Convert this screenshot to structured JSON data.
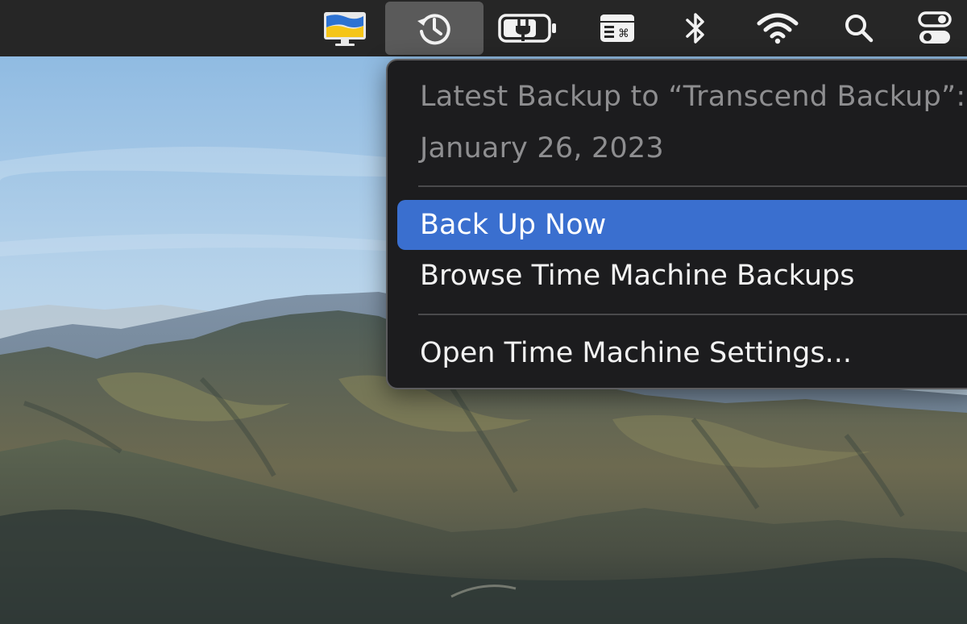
{
  "menubar": {
    "items": [
      {
        "id": "ukraine-monitor",
        "icon": "ukraine-flag-display-icon",
        "active": false
      },
      {
        "id": "time-machine",
        "icon": "time-machine-clock-icon",
        "active": true
      },
      {
        "id": "battery",
        "icon": "battery-charging-icon",
        "active": false
      },
      {
        "id": "keyboard-shortcuts",
        "icon": "command-window-icon",
        "active": false
      },
      {
        "id": "bluetooth",
        "icon": "bluetooth-icon",
        "active": false
      },
      {
        "id": "wifi",
        "icon": "wifi-icon",
        "active": false
      },
      {
        "id": "spotlight",
        "icon": "search-icon",
        "active": false
      },
      {
        "id": "control-center",
        "icon": "control-center-toggle-icon",
        "active": false
      }
    ]
  },
  "time_machine_menu": {
    "header_line1": "Latest Backup to “Transcend Backup”:",
    "header_line2": "January 26, 2023",
    "items": [
      {
        "label": "Back Up Now",
        "selected": true
      },
      {
        "label": "Browse Time Machine Backups",
        "selected": false
      },
      {
        "label": "Open Time Machine Settings...",
        "selected": false
      }
    ]
  },
  "colors": {
    "menubar_bg": "#262626",
    "menu_bg": "#1c1c1e",
    "selection_blue": "#3a6fcf",
    "header_gray": "#8e8e90"
  }
}
